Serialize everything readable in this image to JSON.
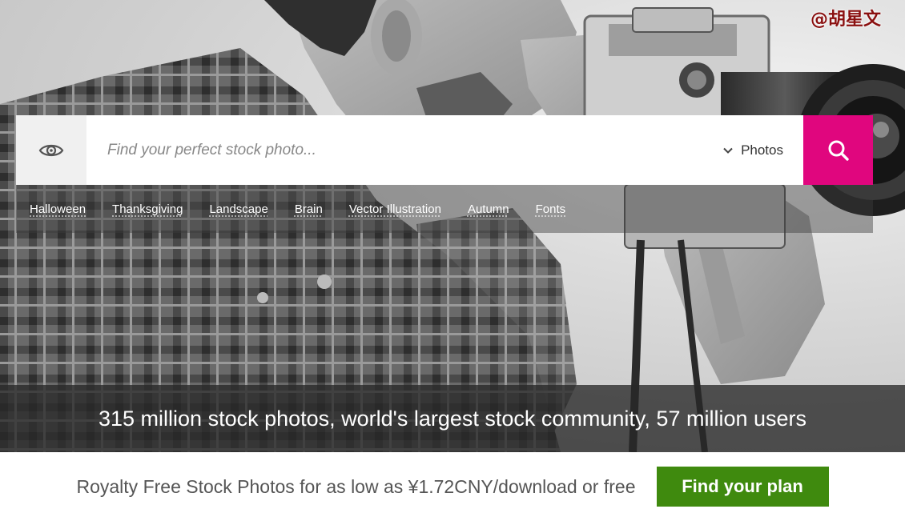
{
  "watermark": "@胡星文",
  "search": {
    "placeholder": "Find your perfect stock photo...",
    "type_label": "Photos",
    "accent_color": "#e0067e"
  },
  "tags": [
    "Halloween",
    "Thanksgiving",
    "Landscape",
    "Brain",
    "Vector Illustration",
    "Autumn",
    "Fonts"
  ],
  "hero": {
    "stats_text": "315 million stock photos, world's largest stock community, 57 million users"
  },
  "promo": {
    "text": "Royalty Free Stock Photos for as low as ¥1.72CNY/download or free",
    "button_label": "Find your plan",
    "button_color": "#3f8a0e"
  },
  "icons": {
    "search_scope": "eye-icon",
    "dropdown": "chevron-down-icon",
    "search": "search-icon"
  }
}
